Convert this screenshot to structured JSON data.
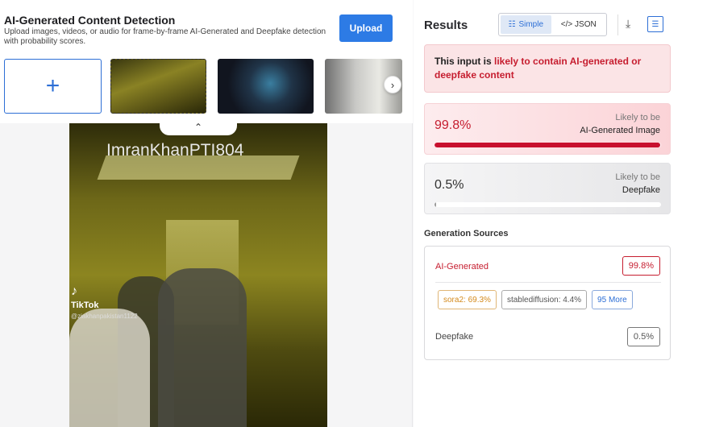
{
  "header": {
    "title": "AI-Generated Content Detection",
    "subtitle": "Upload images, videos, or audio for frame-by-frame AI-Generated and Deepfake detection with probability scores.",
    "upload_label": "Upload"
  },
  "gallery": {
    "add_icon": "plus-icon",
    "next_icon": "chevron-right-icon",
    "collapse_icon": "chevron-up-icon"
  },
  "preview": {
    "watermark": "ImranKhanPTI804",
    "tiktok_logo": "♪",
    "tiktok_name": "TikTok",
    "tiktok_handle": "@ziakhanpakistan1122"
  },
  "results": {
    "title": "Results",
    "toggle_simple": "Simple",
    "toggle_json": "</> JSON",
    "download_icon": "download-icon",
    "list_icon": "list-view-icon",
    "alert_prefix": "This input is ",
    "alert_highlight": "likely to contain AI-generated or deepfake content",
    "scores": [
      {
        "value": "99.8%",
        "likely": "Likely to be",
        "label": "AI-Generated Image",
        "fraction": 0.998
      },
      {
        "value": "0.5%",
        "likely": "Likely to be",
        "label": "Deepfake",
        "fraction": 0.005
      }
    ]
  },
  "generation_sources": {
    "title": "Generation Sources",
    "ai_label": "AI-Generated",
    "ai_value": "99.8%",
    "chips": {
      "sora": "sora2: 69.3%",
      "stablediffusion": "stablediffusion: 4.4%",
      "more": "95 More"
    },
    "deepfake_label": "Deepfake",
    "deepfake_value": "0.5%"
  },
  "colors": {
    "accent_blue": "#2d7be5",
    "alert_red": "#c61d2f"
  }
}
